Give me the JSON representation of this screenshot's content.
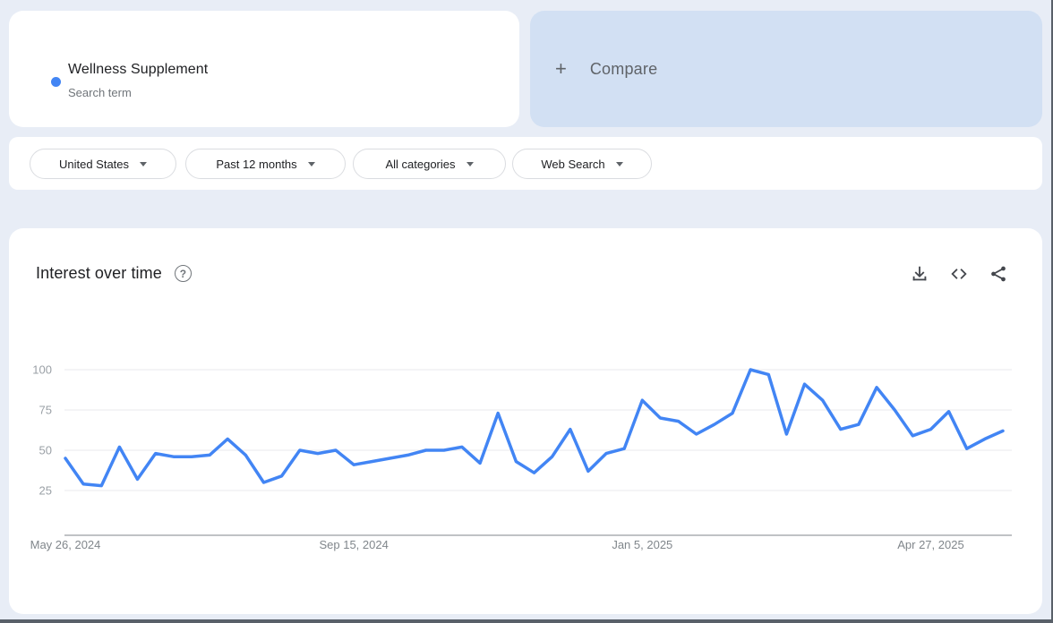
{
  "term_card": {
    "term": "Wellness Supplement",
    "subtitle": "Search term",
    "dot_color": "#4285f4"
  },
  "compare_card": {
    "plus": "+",
    "label": "Compare"
  },
  "filters": [
    {
      "id": "geo",
      "label": "United States"
    },
    {
      "id": "time",
      "label": "Past 12 months"
    },
    {
      "id": "category",
      "label": "All categories"
    },
    {
      "id": "property",
      "label": "Web Search"
    }
  ],
  "interest_card": {
    "title": "Interest over time",
    "help_icon": "question-mark-circle-icon",
    "toolbar_icons": [
      "download-icon",
      "embed-icon",
      "share-icon"
    ]
  },
  "colors": {
    "accent_blue": "#4285f4",
    "page_bg": "#e8edf6",
    "compare_bg": "#d2e0f3",
    "text_dark": "#202124",
    "text_muted": "#5f6368",
    "y_tick": "#9aa0a6",
    "x_tick": "#80868b",
    "gridline": "#e8eaed",
    "axis_line": "#80868b",
    "pill_border": "#dadce0"
  },
  "chart_data": {
    "type": "line",
    "title": "Interest over time",
    "xlabel": "",
    "ylabel": "",
    "ylim": [
      0,
      100
    ],
    "y_ticks": [
      25,
      50,
      75,
      100
    ],
    "grid": true,
    "legend": false,
    "x_unit": "week",
    "num_points": 53,
    "x_tick_labels": [
      {
        "label": "May 26, 2024",
        "week_index": 0
      },
      {
        "label": "Sep 15, 2024",
        "week_index": 16
      },
      {
        "label": "Jan 5, 2025",
        "week_index": 32
      },
      {
        "label": "Apr 27, 2025",
        "week_index": 48
      }
    ],
    "series": [
      {
        "name": "Wellness Supplement",
        "color": "#4285f4",
        "values": [
          45,
          29,
          28,
          52,
          32,
          48,
          46,
          46,
          47,
          57,
          47,
          30,
          34,
          50,
          48,
          50,
          41,
          43,
          45,
          47,
          50,
          50,
          52,
          42,
          73,
          43,
          36,
          46,
          63,
          37,
          48,
          51,
          81,
          70,
          68,
          60,
          66,
          73,
          100,
          97,
          60,
          91,
          81,
          63,
          66,
          89,
          75,
          59,
          63,
          74,
          51,
          57,
          62
        ]
      }
    ]
  }
}
